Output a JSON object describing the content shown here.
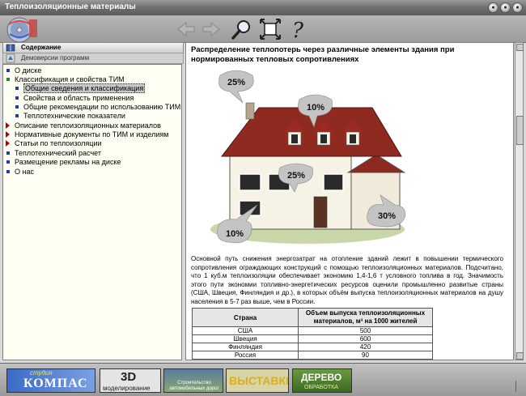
{
  "window": {
    "title": "Теплоизоляционные материалы"
  },
  "sidebar": {
    "header": "Содержание",
    "demo_label": "Демоверсии программ",
    "items": [
      {
        "label": "О диске"
      },
      {
        "label": "Классификация и свойства ТИМ"
      },
      {
        "label": "Общие сведения и классификация",
        "selected": true
      },
      {
        "label": "Свойства и область применения"
      },
      {
        "label": "Общие рекомендации по использованию ТИМ"
      },
      {
        "label": "Теплотехнические показатели"
      },
      {
        "label": "Описание теплоизоляционных материалов"
      },
      {
        "label": "Нормативные документы по ТИМ и изделиям"
      },
      {
        "label": "Статьи по теплоизоляции"
      },
      {
        "label": "Теплотехнический расчет"
      },
      {
        "label": "Размещение рекламы на диске"
      },
      {
        "label": "О нас"
      }
    ]
  },
  "content": {
    "heading": "Распределение теплопотерь через различные элементы здания при нормированных тепловых сопротивлениях",
    "figure_labels": {
      "roof": "25%",
      "upper": "10%",
      "windows": "25%",
      "walls": "10%",
      "floor": "30%"
    },
    "paragraph": "Основной путь снижения энергозатрат на отопление зданий лежит в повышении термического сопротивления ограждающих конструкций с помощью теплоизоляционных материалов. Подсчитано, что 1 куб.м теплоизоляции обеспечивает экономию 1,4-1,6 т условного топлива в год. Значимость этого пути экономии топливно-энергетических ресурсов оценили промышленно развитые страны (США, Швеция, Финляндия и др.), в которых объём выпуска теплоизоляционных материалов на душу населения в 5-7 раз выше, чем в России.",
    "table": {
      "header": [
        "Страна",
        "Объем выпуска теплоизоляционных материалов, м³ на 1000 жителей"
      ],
      "rows": [
        [
          "США",
          "500"
        ],
        [
          "Швеция",
          "600"
        ],
        [
          "Финляндия",
          "420"
        ],
        [
          "Россия",
          "90"
        ]
      ]
    }
  },
  "banners": {
    "kompas_top": "студия",
    "kompas_main": "КОМПАС",
    "three_d": "3D",
    "modeling": "моделирование",
    "roads": "Строительство автомобильных дорог",
    "exhibitions": "ВЫСТАВКИ",
    "wood_top": "ДЕРЕВО",
    "wood_bottom": "ОБРАБОТКА"
  },
  "colors": {
    "accent": "#0c3a7a",
    "selected_bg": "#c8c8c8",
    "tree_bg": "#fefff2",
    "bullet_blue": "#1a3fa8",
    "bullet_green": "#1f8a2a",
    "chevron_red": "#b00000"
  }
}
